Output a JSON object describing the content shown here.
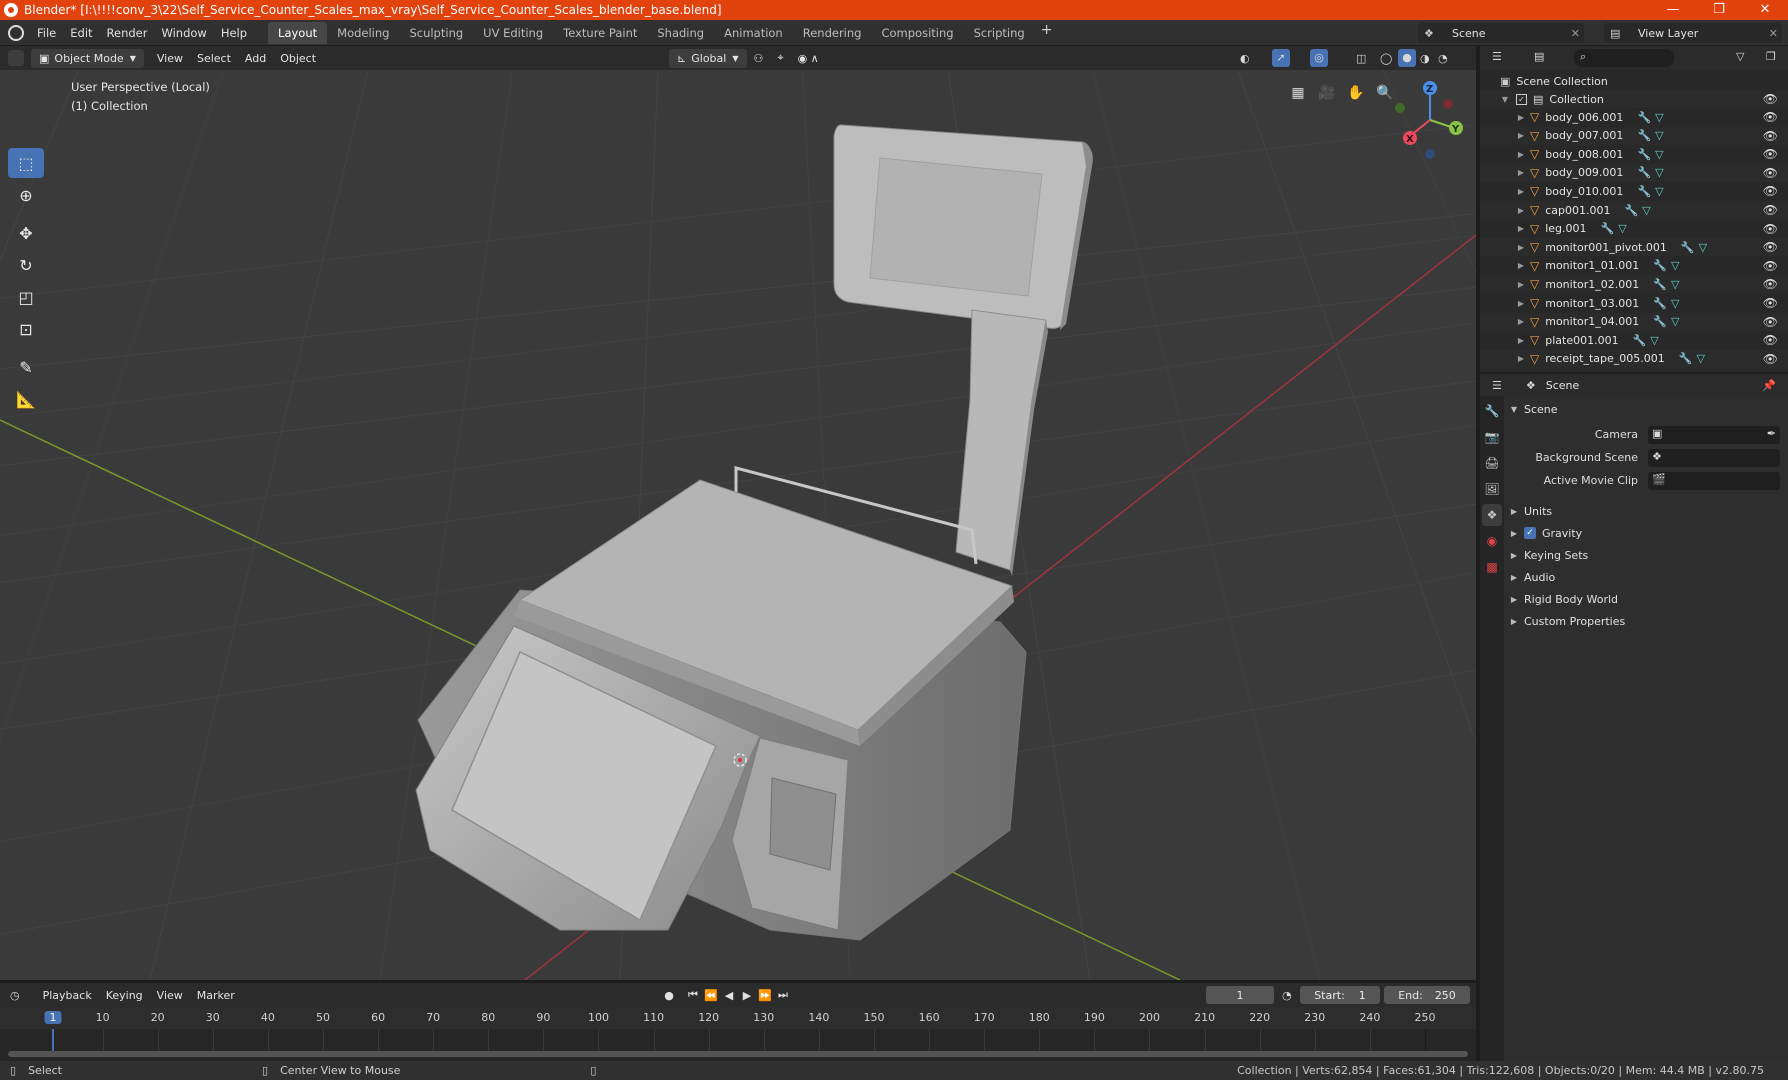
{
  "window": {
    "title": "Blender* [I:\\!!!!conv_3\\22\\Self_Service_Counter_Scales_max_vray\\Self_Service_Counter_Scales_blender_base.blend]",
    "controls": [
      "—",
      "❐",
      "✕"
    ]
  },
  "menu": [
    "File",
    "Edit",
    "Render",
    "Window",
    "Help"
  ],
  "workspaces": [
    "Layout",
    "Modeling",
    "Sculpting",
    "UV Editing",
    "Texture Paint",
    "Shading",
    "Animation",
    "Rendering",
    "Compositing",
    "Scripting"
  ],
  "active_workspace": "Layout",
  "scene_selector": "Scene",
  "view_layer_selector": "View Layer",
  "viewport_header": {
    "mode": "Object Mode",
    "menus": [
      "View",
      "Select",
      "Add",
      "Object"
    ],
    "transform_orientation": "Global"
  },
  "viewport": {
    "perspective_label": "User Perspective (Local)",
    "collection_label": "(1) Collection",
    "gizmo_axes": [
      "X",
      "Y",
      "Z"
    ]
  },
  "toolbar_tools": [
    "select-box",
    "cursor",
    "move",
    "rotate",
    "scale",
    "transform",
    "annotate",
    "measure"
  ],
  "outliner": {
    "root": "Scene Collection",
    "collection": "Collection",
    "objects": [
      "body_006.001",
      "body_007.001",
      "body_008.001",
      "body_009.001",
      "body_010.001",
      "cap001.001",
      "leg.001",
      "monitor001_pivot.001",
      "monitor1_01.001",
      "monitor1_02.001",
      "monitor1_03.001",
      "monitor1_04.001",
      "plate001.001",
      "receipt_tape_005.001"
    ]
  },
  "properties": {
    "context": "Scene",
    "panel_title": "Scene",
    "fields": [
      {
        "label": "Camera"
      },
      {
        "label": "Background Scene"
      },
      {
        "label": "Active Movie Clip"
      }
    ],
    "subpanels": [
      "Units",
      "Gravity",
      "Keying Sets",
      "Audio",
      "Rigid Body World",
      "Custom Properties"
    ],
    "gravity_checked": true
  },
  "timeline": {
    "menus": [
      "Playback",
      "Keying",
      "View",
      "Marker"
    ],
    "current_frame": "1",
    "start_label": "Start:",
    "start": "1",
    "end_label": "End:",
    "end": "250",
    "ruler": [
      "1",
      "10",
      "20",
      "30",
      "40",
      "50",
      "60",
      "70",
      "80",
      "90",
      "100",
      "110",
      "120",
      "130",
      "140",
      "150",
      "160",
      "170",
      "180",
      "190",
      "200",
      "210",
      "220",
      "230",
      "240",
      "250"
    ]
  },
  "statusbar": {
    "select": "Select",
    "center_view": "Center View to Mouse",
    "stats": "Collection | Verts:62,854 | Faces:61,304 | Tris:122,608 | Objects:0/20 | Mem: 44.4 MB | v2.80.75"
  },
  "colors": {
    "titlebar": "#e2420d",
    "accent": "#4772b3",
    "axis_x": "#e84a5f",
    "axis_y": "#8bc34a",
    "axis_z": "#4a8fe8"
  }
}
